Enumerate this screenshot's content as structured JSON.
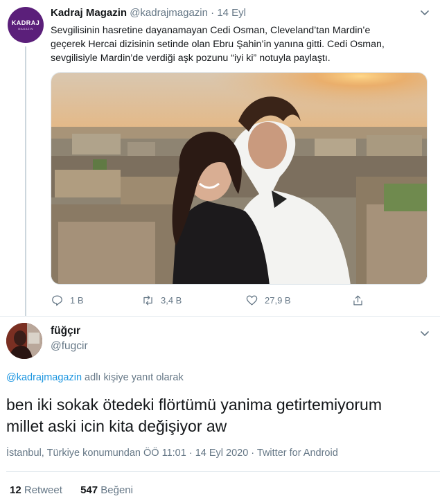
{
  "tweet1": {
    "author_name": "Kadraj Magazin",
    "handle": "@kadrajmagazin",
    "separator": "·",
    "date": "14 Eyl",
    "avatar_text": "KADRAJ",
    "avatar_subtext": "MAGAZIN",
    "text_lines": [
      "Sevgilisinin hasretine dayanamayan Cedi Osman, Cleveland’tan Mardin’e",
      "geçerek Hercai dizisinin setinde olan Ebru Şahin’in yanına gitti. Cedi Osman,",
      "sevgilisiyle Mardin’de verdiği aşk pozunu “iyi ki” notuyla paylaştı."
    ],
    "actions": {
      "replies": "1 B",
      "retweets": "3,4 B",
      "likes": "27,9 B"
    }
  },
  "tweet2": {
    "author_name": "füğçır",
    "handle": "@fugcir",
    "reply_mention": "@kadrajmagazin",
    "reply_suffix": " adlı kişiye yanıt olarak",
    "text_lines": [
      "ben iki sokak ötedeki flörtümü yanima getirtemiyorum",
      "millet aski icin kita değişiyor aw"
    ],
    "meta": "İstanbul, Türkiye konumundan ÖÖ 11:01 · 14 Eyl 2020 · Twitter for Android",
    "retweet_count": "12",
    "retweet_label": "Retweet",
    "like_count": "547",
    "like_label": "Beğeni"
  },
  "colors": {
    "brand_purple": "#5b1f7a",
    "secondary_text": "#657786",
    "link": "#1b95e0"
  }
}
